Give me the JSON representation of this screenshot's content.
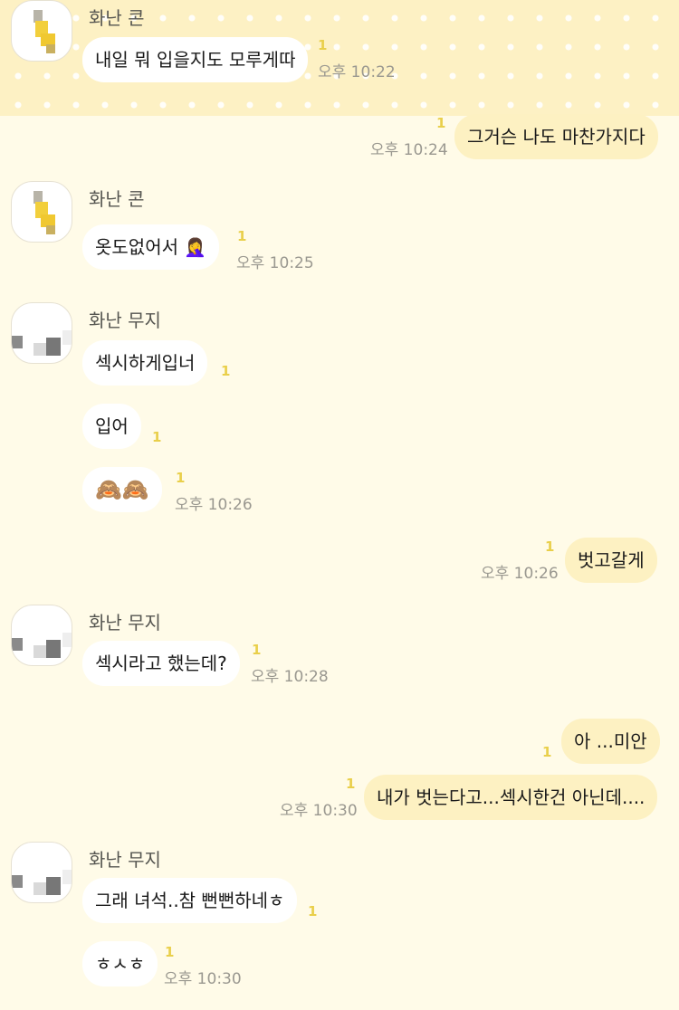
{
  "colors": {
    "background": "#fffbe8",
    "highlight_band": "#fdf1c4",
    "bubble_in": "#ffffff",
    "bubble_out": "#fdf1c2",
    "unread": "#e9cf4a",
    "time": "#9a9890"
  },
  "senders": {
    "kon": "화난 콘",
    "muzi": "화난 무지"
  },
  "messages": [
    {
      "text": "내일 뭐 입을지도 모루게따",
      "unread": "1",
      "time": "오후 10:22"
    },
    {
      "text": "그거슨 나도 마찬가지다",
      "unread": "1",
      "time": "오후 10:24"
    },
    {
      "text": "옷도없어서 🤦‍♀️",
      "unread": "1",
      "time": "오후 10:25"
    },
    {
      "text": "섹시하게입너",
      "unread": "1"
    },
    {
      "text": "입어",
      "unread": "1"
    },
    {
      "text": "🙈🙈",
      "unread": "1",
      "time": "오후 10:26"
    },
    {
      "text": "벗고갈게",
      "unread": "1",
      "time": "오후 10:26"
    },
    {
      "text": "섹시라고 했는데?",
      "unread": "1",
      "time": "오후 10:28"
    },
    {
      "text": "아 ...미안",
      "unread": "1"
    },
    {
      "text": "내가 벗는다고...섹시한건 아닌데....",
      "unread": "1",
      "time": "오후 10:30"
    },
    {
      "text": "그래 녀석..참 뻔뻔하네ㅎ",
      "unread": "1"
    },
    {
      "text": "ㅎㅅㅎ",
      "unread": "1",
      "time": "오후 10:30"
    }
  ]
}
